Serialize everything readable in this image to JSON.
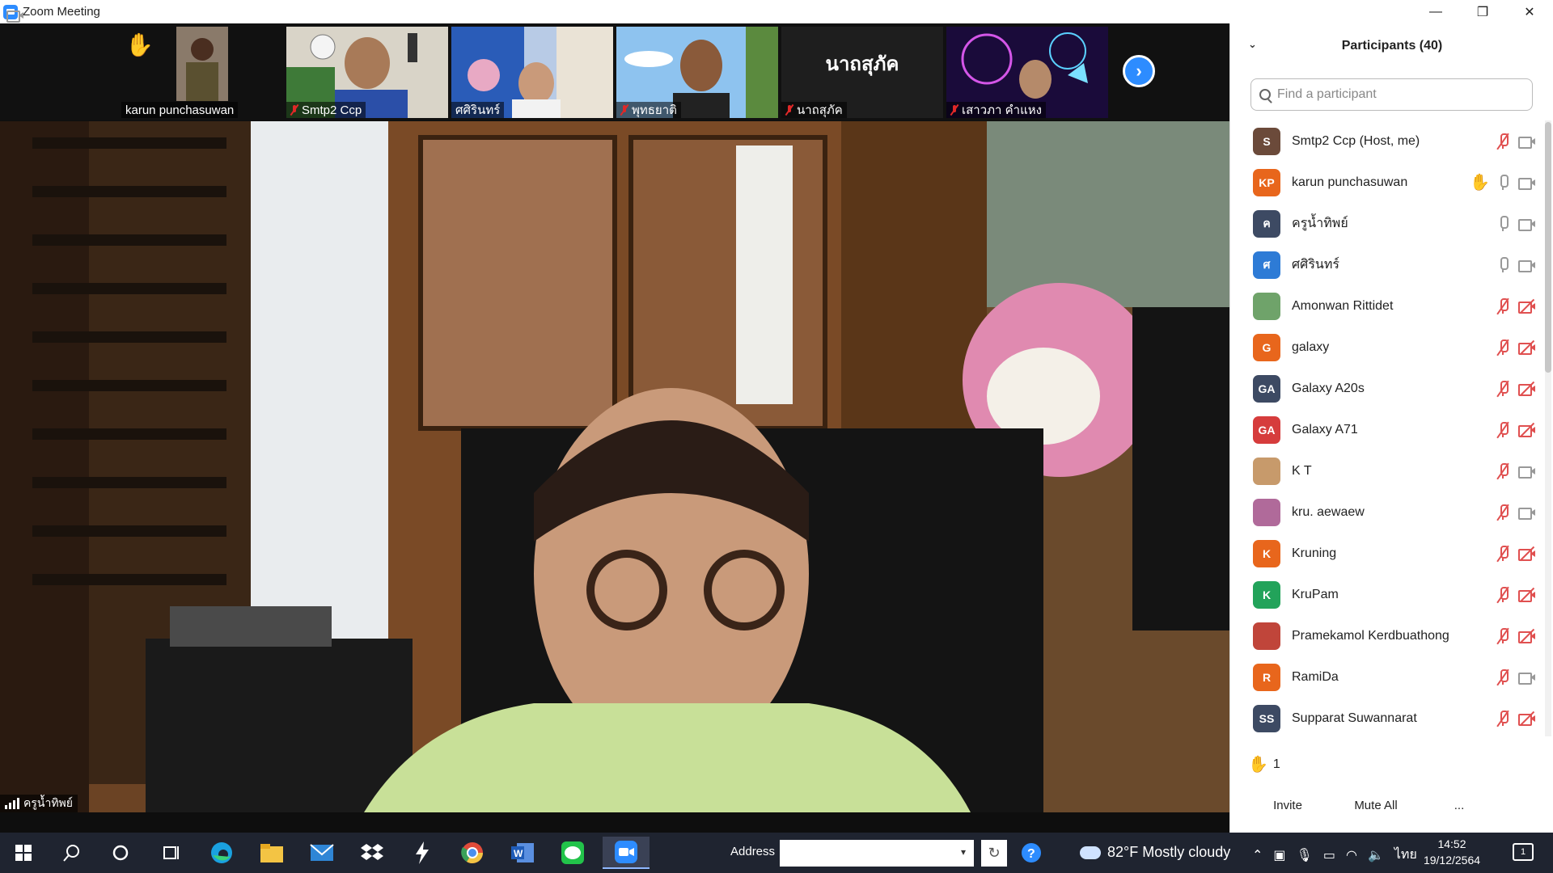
{
  "window": {
    "title": "Zoom Meeting",
    "minimize": "—",
    "maximize": "❐",
    "close": "✕"
  },
  "strip": {
    "tiles": [
      {
        "name": "karun punchasuwan",
        "muted": false,
        "hand_raised": true
      },
      {
        "name": "Smtp2 Ccp",
        "muted": true
      },
      {
        "name": "ศศิรินทร์",
        "muted": false
      },
      {
        "name": "พุทธยาติ",
        "muted": true
      },
      {
        "name": "นาถสุภัค",
        "muted": true,
        "big_name": "นาถสุภัค"
      },
      {
        "name": "เสาวภา  คำแหง",
        "muted": true
      }
    ],
    "next_glyph": "›"
  },
  "speaker": {
    "name": "ครูน้ำทิพย์"
  },
  "panel": {
    "title": "Participants (40)",
    "search_placeholder": "Find a participant",
    "participants": [
      {
        "initials": "S",
        "name": "Smtp2 Ccp (Host, me)",
        "color": "#6b4a3a",
        "mic": "off",
        "cam": "on"
      },
      {
        "initials": "KP",
        "name": "karun punchasuwan",
        "color": "#e8661c",
        "hand": true,
        "mic": "on",
        "cam": "on"
      },
      {
        "initials": "ค",
        "name": "ครูน้ำทิพย์",
        "color": "#3d4a63",
        "mic": "on",
        "cam": "on"
      },
      {
        "initials": "ศ",
        "name": "ศศิรินทร์",
        "color": "#2d7bd6",
        "mic": "on",
        "cam": "on"
      },
      {
        "initials": "",
        "name": "Amonwan Rittidet",
        "color": "#6fa36a",
        "photo": true,
        "mic": "off",
        "cam": "off"
      },
      {
        "initials": "G",
        "name": "galaxy",
        "color": "#e8661c",
        "mic": "off",
        "cam": "off"
      },
      {
        "initials": "GA",
        "name": "Galaxy A20s",
        "color": "#3d4a63",
        "mic": "off",
        "cam": "off"
      },
      {
        "initials": "GA",
        "name": "Galaxy A71",
        "color": "#d63c3c",
        "mic": "off",
        "cam": "off"
      },
      {
        "initials": "",
        "name": "K T",
        "color": "#c79a6b",
        "photo": true,
        "mic": "off",
        "cam": "on"
      },
      {
        "initials": "",
        "name": "kru. aewaew",
        "color": "#b06a9a",
        "photo": true,
        "mic": "off",
        "cam": "on"
      },
      {
        "initials": "K",
        "name": "Kruning",
        "color": "#e8661c",
        "mic": "off",
        "cam": "off"
      },
      {
        "initials": "K",
        "name": "KruPam",
        "color": "#22a35a",
        "mic": "off",
        "cam": "off"
      },
      {
        "initials": "",
        "name": "Pramekamol Kerdbuathong",
        "color": "#c0453a",
        "photo": true,
        "mic": "off",
        "cam": "off"
      },
      {
        "initials": "R",
        "name": "RamiDa",
        "color": "#e8661c",
        "mic": "off",
        "cam": "on"
      },
      {
        "initials": "SS",
        "name": "Supparat Suwannarat",
        "color": "#3d4a63",
        "mic": "off",
        "cam": "off"
      }
    ],
    "raised_count": "1",
    "invite_label": "Invite",
    "mute_all_label": "Mute All",
    "more_label": "..."
  },
  "taskbar": {
    "address_label": "Address",
    "weather": "82°F  Mostly cloudy",
    "lang": "ไทย",
    "time": "14:52",
    "date": "19/12/2564",
    "notif_count": "1"
  }
}
